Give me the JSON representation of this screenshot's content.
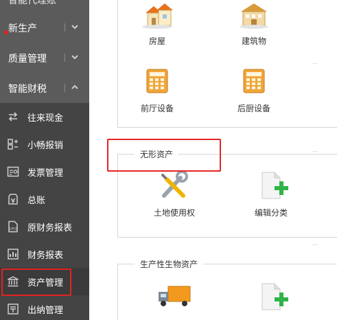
{
  "sidebar": {
    "cut_top_label": "智能代理账",
    "main_items": [
      {
        "label": "新生产"
      },
      {
        "label": "质量管理"
      },
      {
        "label": "智能财税"
      }
    ],
    "sub_items": [
      {
        "label": "往来现金",
        "icon": "exchange-icon"
      },
      {
        "label": "小畅报销",
        "icon": "reimburse-icon"
      },
      {
        "label": "发票管理",
        "icon": "invoice-icon"
      },
      {
        "label": "总账",
        "icon": "ledger-icon"
      },
      {
        "label": "原财务报表",
        "icon": "ufo-report-icon"
      },
      {
        "label": "财务报表",
        "icon": "report-icon"
      },
      {
        "label": "资产管理",
        "icon": "bank-icon"
      },
      {
        "label": "出纳管理",
        "icon": "cashier-icon"
      }
    ]
  },
  "main": {
    "fixed_assets": {
      "tiles": [
        {
          "label": "房屋",
          "icon": "houses-icon"
        },
        {
          "label": "建筑物",
          "icon": "building-icon"
        },
        {
          "label": "前厅设备",
          "icon": "cash-register-icon"
        },
        {
          "label": "后厨设备",
          "icon": "cash-register-icon"
        }
      ]
    },
    "intangible_assets": {
      "title": "无形资产",
      "tiles": [
        {
          "label": "土地使用权",
          "icon": "tools-icon"
        },
        {
          "label": "编辑分类",
          "icon": "add-document-icon"
        }
      ]
    },
    "biological_assets": {
      "title": "生产性生物资产",
      "tiles": [
        {
          "label": "",
          "icon": "truck-icon"
        },
        {
          "label": "",
          "icon": "add-document-icon"
        }
      ]
    }
  },
  "colors": {
    "sidebar_bg": "#5b5b5b",
    "submenu_bg": "#444444",
    "highlight_red": "#e52222"
  }
}
